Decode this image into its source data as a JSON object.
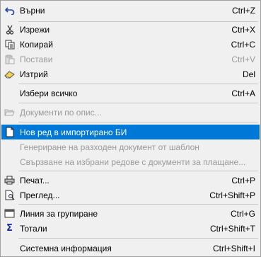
{
  "menu": {
    "items": [
      {
        "label": "Върни",
        "shortcut": "Ctrl+Z",
        "icon": "undo-icon"
      },
      {
        "label": "Изрежи",
        "shortcut": "Ctrl+X",
        "icon": "scissors-icon"
      },
      {
        "label": "Копирай",
        "shortcut": "Ctrl+C",
        "icon": "copy-icon"
      },
      {
        "label": "Постави",
        "shortcut": "Ctrl+V",
        "icon": "paste-icon"
      },
      {
        "label": "Изтрий",
        "shortcut": "Del",
        "icon": "eraser-icon"
      },
      {
        "label": "Избери всичко",
        "shortcut": "Ctrl+A"
      },
      {
        "label": "Документи по опис...",
        "icon": "folder-open-icon"
      },
      {
        "label": "Нов ред в импортирано БИ",
        "icon": "new-document-icon"
      },
      {
        "label": "Генериране на разходен документ от шаблон"
      },
      {
        "label": "Свързване на избрани редове с документи за плащане..."
      },
      {
        "label": "Печат...",
        "shortcut": "Ctrl+P",
        "icon": "printer-icon"
      },
      {
        "label": "Преглед...",
        "shortcut": "Ctrl+Shift+P",
        "icon": "print-preview-icon"
      },
      {
        "label": "Линия за групиране",
        "shortcut": "Ctrl+G",
        "icon": "grouping-bar-icon"
      },
      {
        "label": "Тотали",
        "shortcut": "Ctrl+Shift+T",
        "icon": "sigma-icon"
      },
      {
        "label": "Системна информация",
        "shortcut": "Ctrl+Shift+I"
      }
    ]
  },
  "colors": {
    "accent": "#0078d7",
    "disabled": "#9a9a9a",
    "background": "#f0f0f0"
  }
}
